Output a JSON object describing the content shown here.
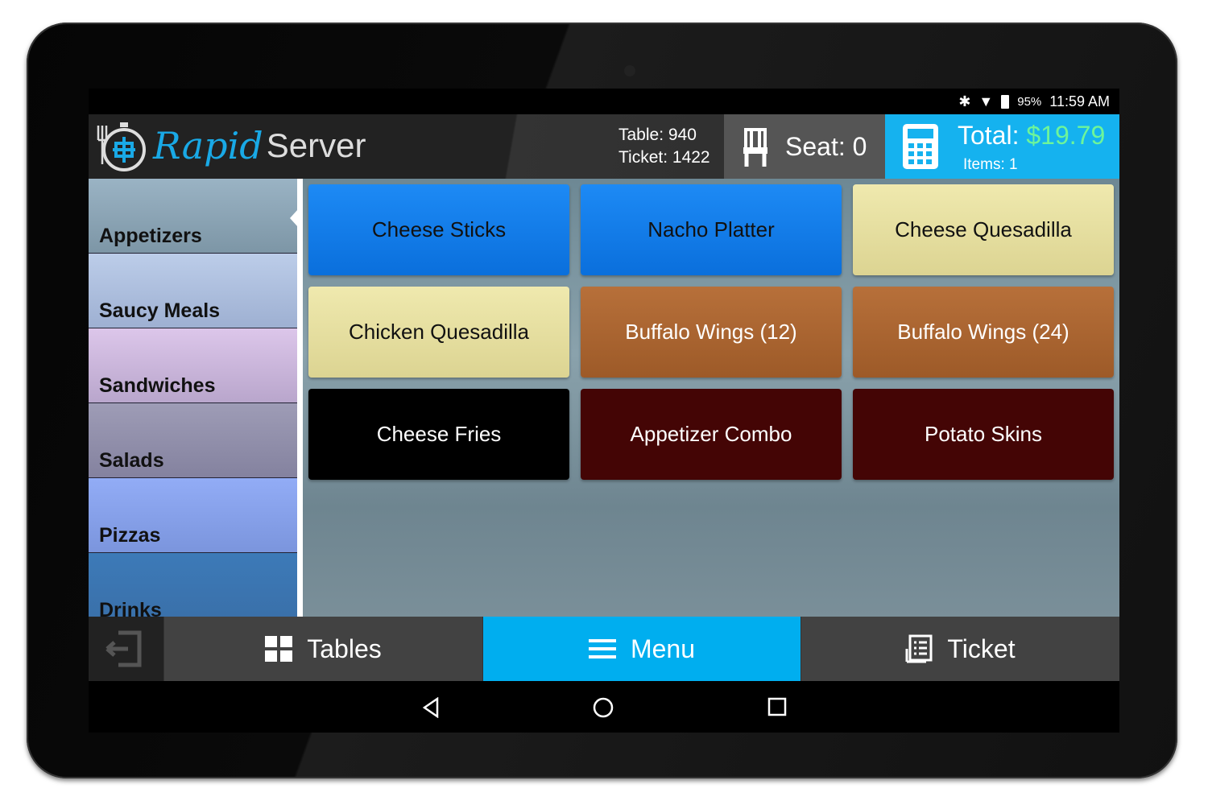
{
  "status": {
    "battery": "95%",
    "time": "11:59 AM"
  },
  "header": {
    "logo_rapid": "Rapid",
    "logo_server": "Server",
    "table": "Table: 940",
    "ticket": "Ticket: 1422",
    "seat_label": "Seat:",
    "seat_value": "0",
    "total_label": "Total:",
    "total_value": "$19.79",
    "items": "Items:  1"
  },
  "sidebar": {
    "items": [
      {
        "label": "Appetizers",
        "color": "#8ea6b6"
      },
      {
        "label": "Saucy Meals",
        "color": "#acbddd"
      },
      {
        "label": "Sandwiches",
        "color": "#cbb5dc"
      },
      {
        "label": "Salads",
        "color": "#908eab"
      },
      {
        "label": "Pizzas",
        "color": "#86a0ea"
      },
      {
        "label": "Drinks",
        "color": "#3a76b2"
      }
    ]
  },
  "menu_items": [
    {
      "label": "Cheese Sticks",
      "style": "blue"
    },
    {
      "label": "Nacho Platter",
      "style": "blue"
    },
    {
      "label": "Cheese Quesadilla",
      "style": "yellow"
    },
    {
      "label": "Chicken Quesadilla",
      "style": "yellow"
    },
    {
      "label": "Buffalo Wings (12)",
      "style": "orange"
    },
    {
      "label": "Buffalo Wings (24)",
      "style": "orange"
    },
    {
      "label": "Cheese Fries",
      "style": "black"
    },
    {
      "label": "Appetizer Combo",
      "style": "maroon"
    },
    {
      "label": "Potato Skins",
      "style": "maroon"
    }
  ],
  "bottom": {
    "tables": "Tables",
    "menu": "Menu",
    "ticket": "Ticket",
    "active": "Menu"
  },
  "colors": {
    "accent": "#00aeef",
    "total_value": "#6df59a"
  }
}
